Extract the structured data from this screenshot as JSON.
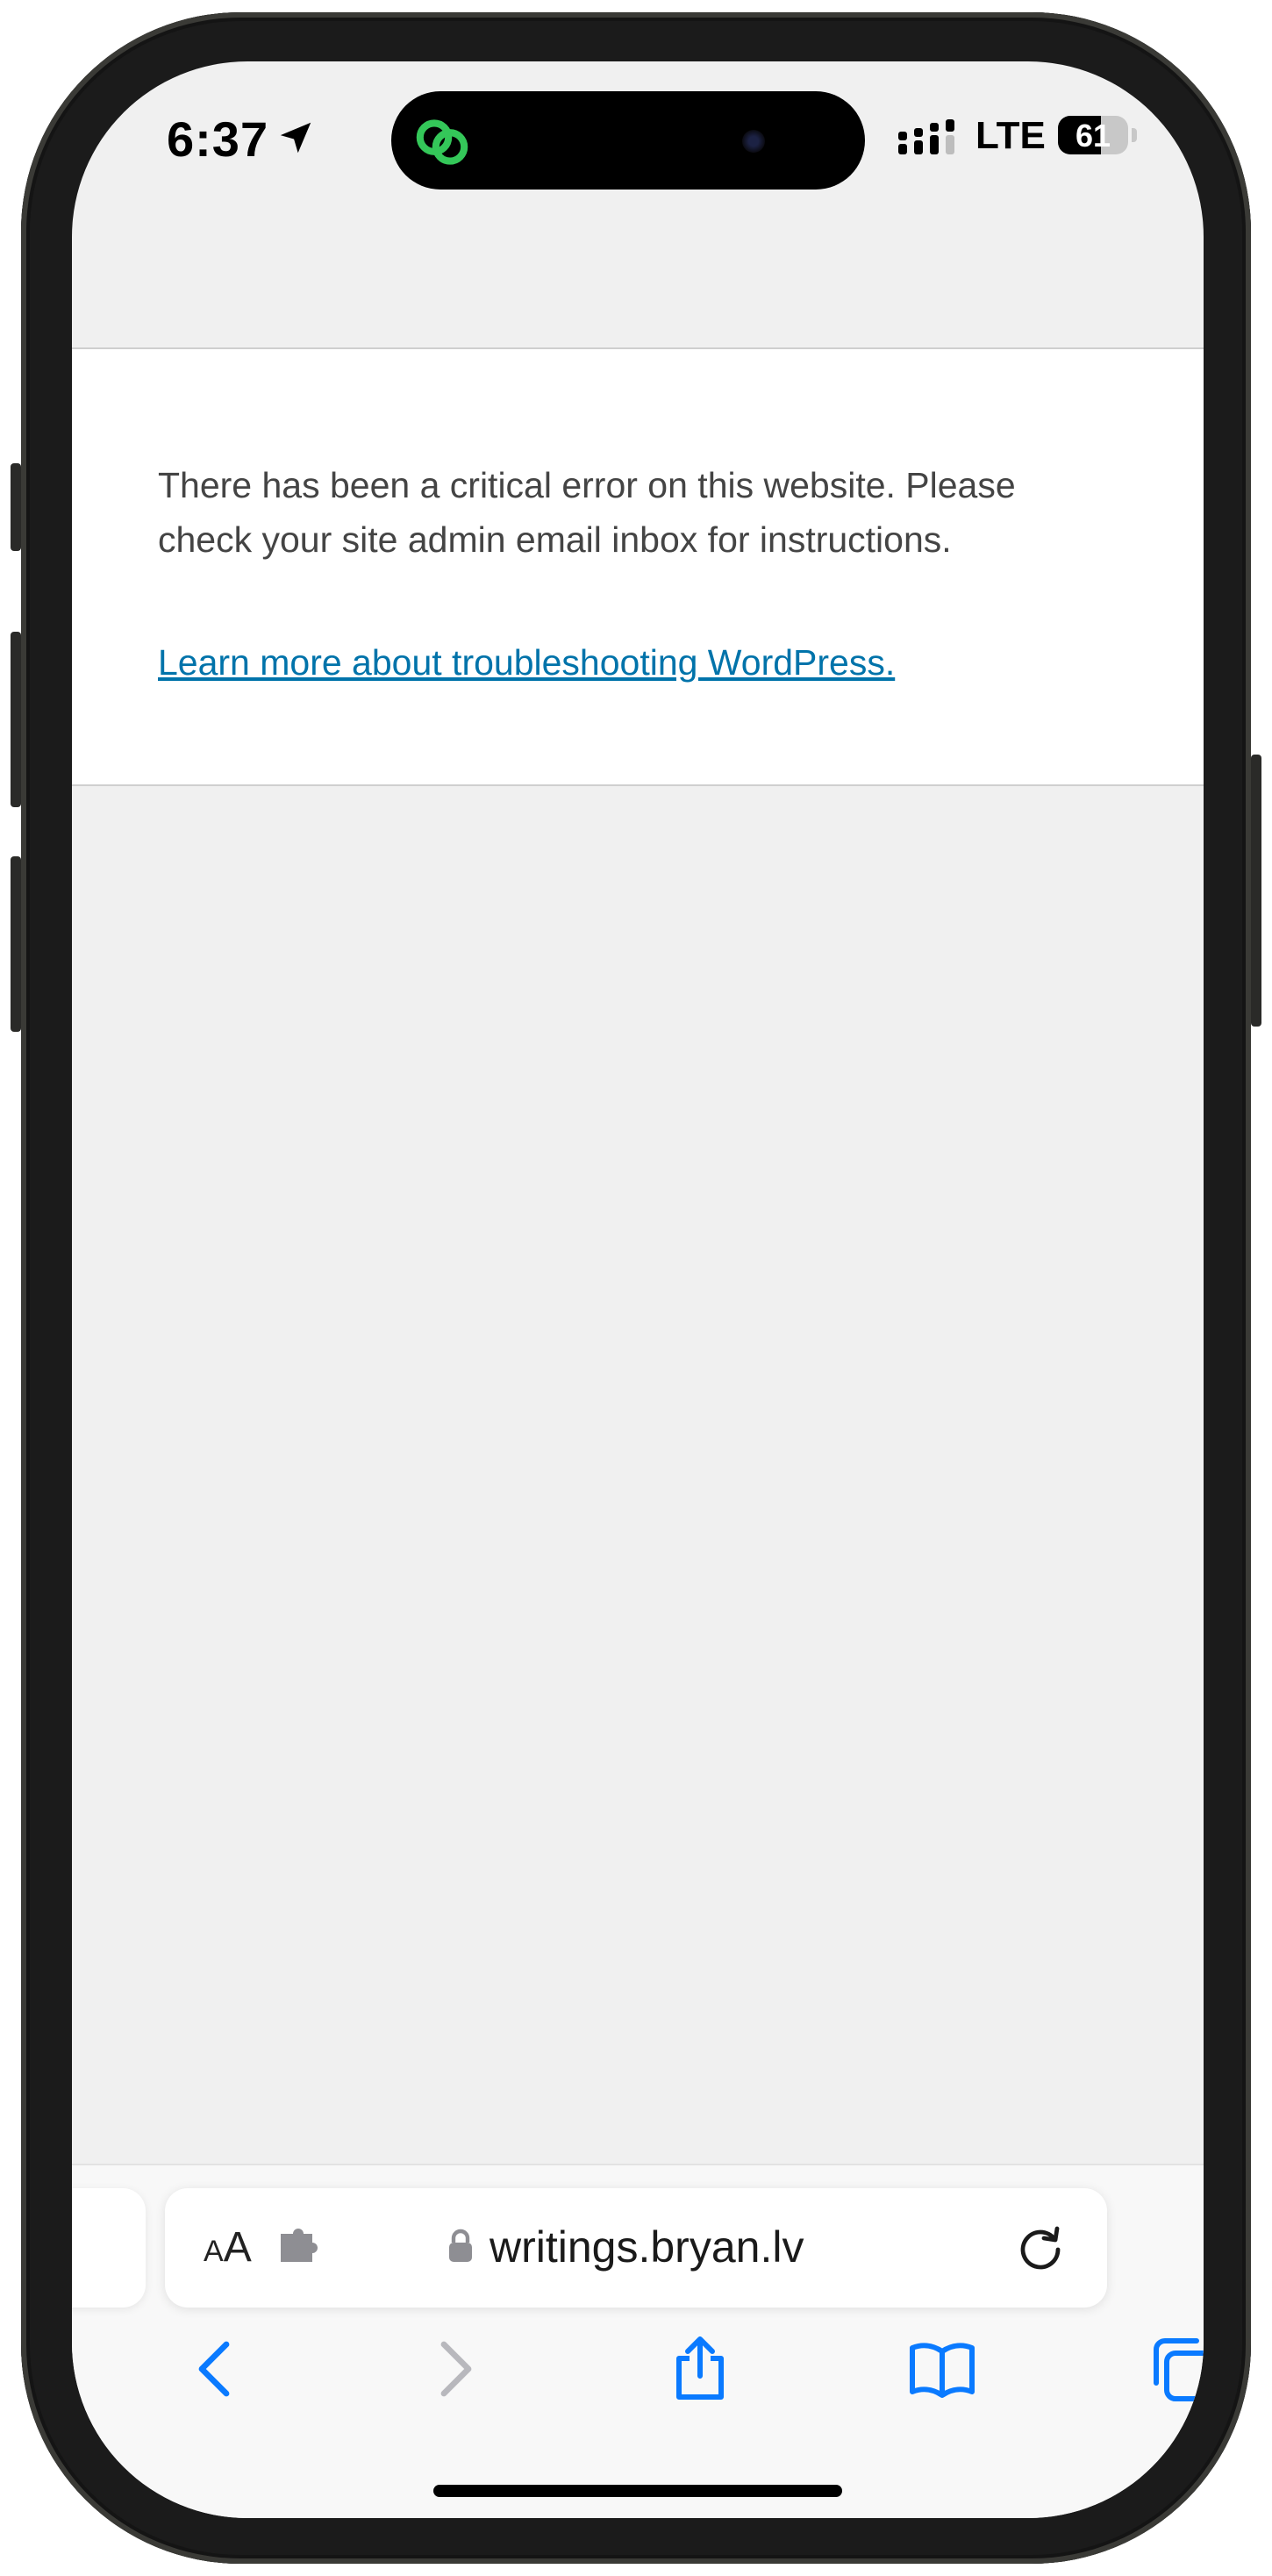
{
  "status_bar": {
    "time": "6:37",
    "network": "LTE",
    "battery_level": "61",
    "battery_fraction": 0.61,
    "location_icon": "location-arrow-icon",
    "island_app_icon": "link-rings-icon",
    "accent_green": "#34c759"
  },
  "page": {
    "error_message": "There has been a critical error on this website. Please check your site admin email inbox for instructions.",
    "help_link": "Learn more about troubleshooting WordPress.",
    "link_color": "#0073aa"
  },
  "address_bar": {
    "text_size_label_small": "A",
    "text_size_label_large": "A",
    "extension_icon": "puzzle-icon",
    "lock_icon": "lock-icon",
    "url": "writings.bryan.lv",
    "reload_icon": "reload-icon"
  },
  "toolbar": {
    "back": "chevron-left-icon",
    "forward": "chevron-right-icon",
    "share": "share-icon",
    "bookmarks": "book-icon",
    "tabs": "tabs-icon",
    "accent_blue": "#0a7aff"
  }
}
